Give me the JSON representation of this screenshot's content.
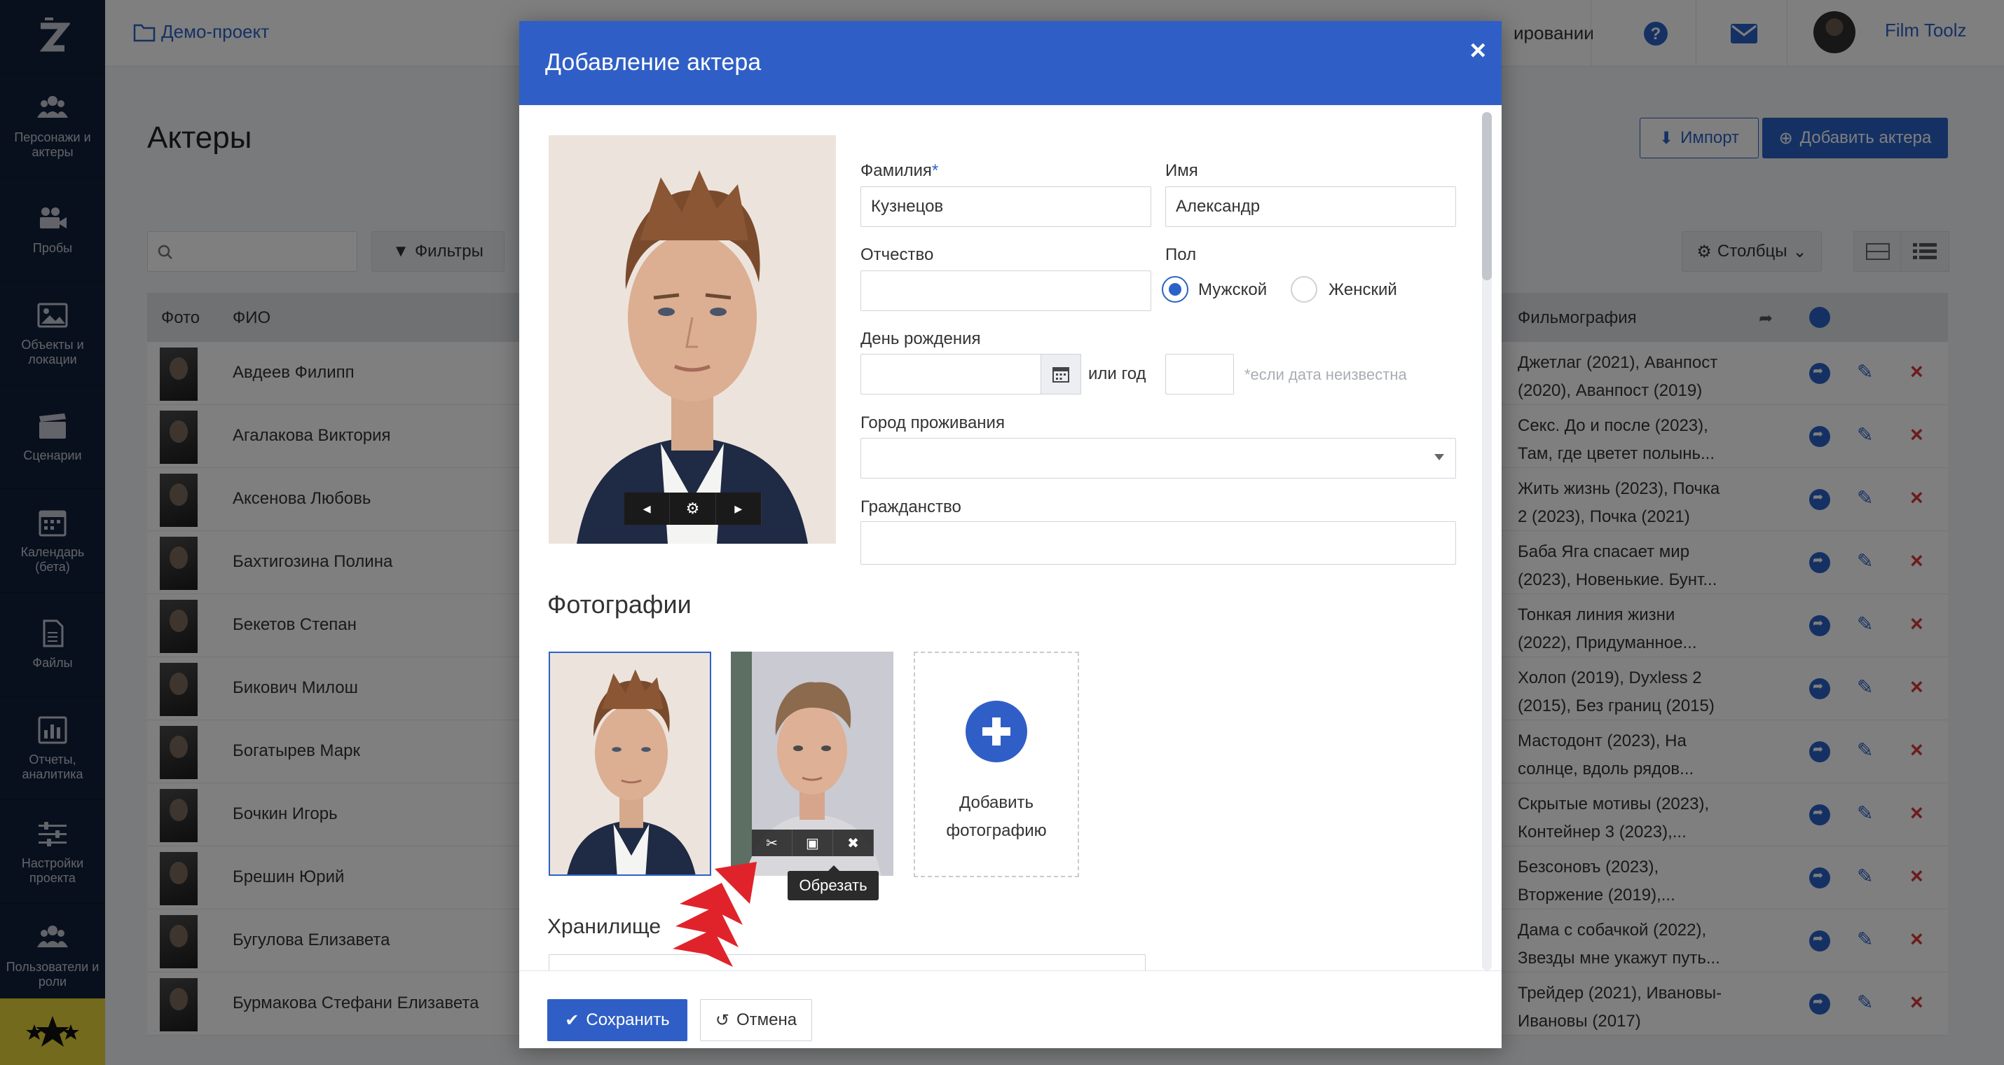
{
  "app": {
    "logo": "Z"
  },
  "sidebar": {
    "items": [
      {
        "label": "Персонажи и актеры",
        "icon": "people-icon"
      },
      {
        "label": "Пробы",
        "icon": "video-camera-icon"
      },
      {
        "label": "Объекты и локации",
        "icon": "image-icon"
      },
      {
        "label": "Сценарии",
        "icon": "clapperboard-icon"
      },
      {
        "label": "Календарь (бета)",
        "icon": "calendar-icon"
      },
      {
        "label": "Файлы",
        "icon": "file-icon"
      },
      {
        "label": "Отчеты, аналитика",
        "icon": "chart-icon"
      },
      {
        "label": "Настройки проекта",
        "icon": "sliders-icon"
      },
      {
        "label": "Пользователи и роли",
        "icon": "users-icon"
      }
    ]
  },
  "header": {
    "project": "Демо-проект",
    "link_fragment": "ировании",
    "username": "Film Toolz"
  },
  "page": {
    "title": "Актеры",
    "import_label": "Импорт",
    "add_label": "Добавить актера",
    "filters_label": "Фильтры",
    "columns_label": "Столбцы",
    "table": {
      "headers": {
        "photo": "Фото",
        "name": "ФИО",
        "films": "Фильмография"
      },
      "rows": [
        {
          "name": "Авдеев Филипп",
          "films1": "Джетлаг (2021), Аванпост",
          "films2": "(2020), Аванпост (2019)"
        },
        {
          "name": "Агалакова Виктория",
          "films1": "Секс. До и после (2023),",
          "films2": "Там, где цветет полынь..."
        },
        {
          "name": "Аксенова Любовь",
          "films1": "Жить жизнь (2023), Почка",
          "films2": "2 (2023), Почка (2021)"
        },
        {
          "name": "Бахтигозина Полина",
          "films1": "Баба Яга спасает мир",
          "films2": "(2023), Новенькие. Бунт..."
        },
        {
          "name": "Бекетов Степан",
          "films1": "Тонкая линия жизни",
          "films2": "(2022), Придуманное..."
        },
        {
          "name": "Бикович Милош",
          "films1": "Холоп (2019), Dyxless 2",
          "films2": "(2015), Без границ (2015)"
        },
        {
          "name": "Богатырев Марк",
          "films1": "Мастодонт (2023), На",
          "films2": "солнце, вдоль рядов..."
        },
        {
          "name": "Бочкин Игорь",
          "films1": "Скрытые мотивы (2023),",
          "films2": "Контейнер 3 (2023),..."
        },
        {
          "name": "Брешин Юрий",
          "films1": "Безсоновъ (2023),",
          "films2": "Вторжение (2019),..."
        },
        {
          "name": "Бугулова Елизавета",
          "films1": "Дама с собачкой (2022),",
          "films2": "Звезды мне укажут путь..."
        },
        {
          "name": "Бурмакова Стефани Елизавета",
          "films1": "Трейдер (2021), Ивановы-",
          "films2": "Ивановы (2017)"
        }
      ]
    }
  },
  "modal": {
    "title": "Добавление актера",
    "fields": {
      "surname_label": "Фамилия",
      "surname_required": "*",
      "surname_value": "Кузнецов",
      "name_label": "Имя",
      "name_value": "Александр",
      "patronymic_label": "Отчество",
      "patronymic_value": "",
      "gender_label": "Пол",
      "gender_male": "Мужской",
      "gender_female": "Женский",
      "gender_selected": "Мужской",
      "birthday_label": "День рождения",
      "birthday_value": "",
      "or_year_label": "или год",
      "year_hint": "*если дата неизвестна",
      "city_label": "Город проживания",
      "city_value": "",
      "citizenship_label": "Гражданство",
      "citizenship_value": ""
    },
    "photos_title": "Фотографии",
    "add_photo_line1": "Добавить",
    "add_photo_line2": "фотографию",
    "crop_tooltip": "Обрезать",
    "storage_title": "Хранилище",
    "save_label": "Сохранить",
    "cancel_label": "Отмена"
  }
}
